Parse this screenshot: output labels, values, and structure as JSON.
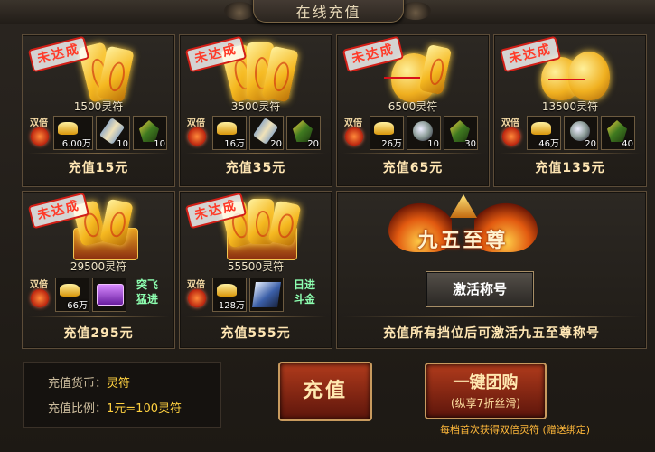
{
  "window": {
    "title": "在线充值"
  },
  "tiers": [
    {
      "status": "未达成",
      "amount": "1500灵符",
      "double_label": "双倍",
      "gold": "6.00万",
      "item2": "10",
      "item3": "10",
      "price": "充值15元"
    },
    {
      "status": "未达成",
      "amount": "3500灵符",
      "double_label": "双倍",
      "gold": "16万",
      "item2": "20",
      "item3": "20",
      "price": "充值35元"
    },
    {
      "status": "未达成",
      "amount": "6500灵符",
      "double_label": "双倍",
      "gold": "26万",
      "item2": "10",
      "item3": "30",
      "price": "充值65元"
    },
    {
      "status": "未达成",
      "amount": "13500灵符",
      "double_label": "双倍",
      "gold": "46万",
      "item2": "20",
      "item3": "40",
      "price": "充值135元"
    },
    {
      "status": "未达成",
      "amount": "29500灵符",
      "double_label": "双倍",
      "gold": "66万",
      "title_item": [
        "突飞",
        "猛进"
      ],
      "price": "充值295元"
    },
    {
      "status": "未达成",
      "amount": "55500灵符",
      "double_label": "双倍",
      "gold": "128万",
      "title_item": [
        "日进",
        "斗金"
      ],
      "price": "充值555元"
    }
  ],
  "supreme": {
    "title": "九五至尊",
    "activate_label": "激活称号",
    "desc": "充值所有挡位后可激活九五至尊称号"
  },
  "info": {
    "currency_label": "充值货币：",
    "currency_value": "灵符",
    "ratio_label": "充值比例：",
    "ratio_value": "1元=100灵符"
  },
  "pay_button": "充值",
  "group_buy": {
    "label": "一键团购",
    "sub": "(纵享7折丝滑)"
  },
  "note": "每档首次获得双倍灵符 (赠送绑定)"
}
